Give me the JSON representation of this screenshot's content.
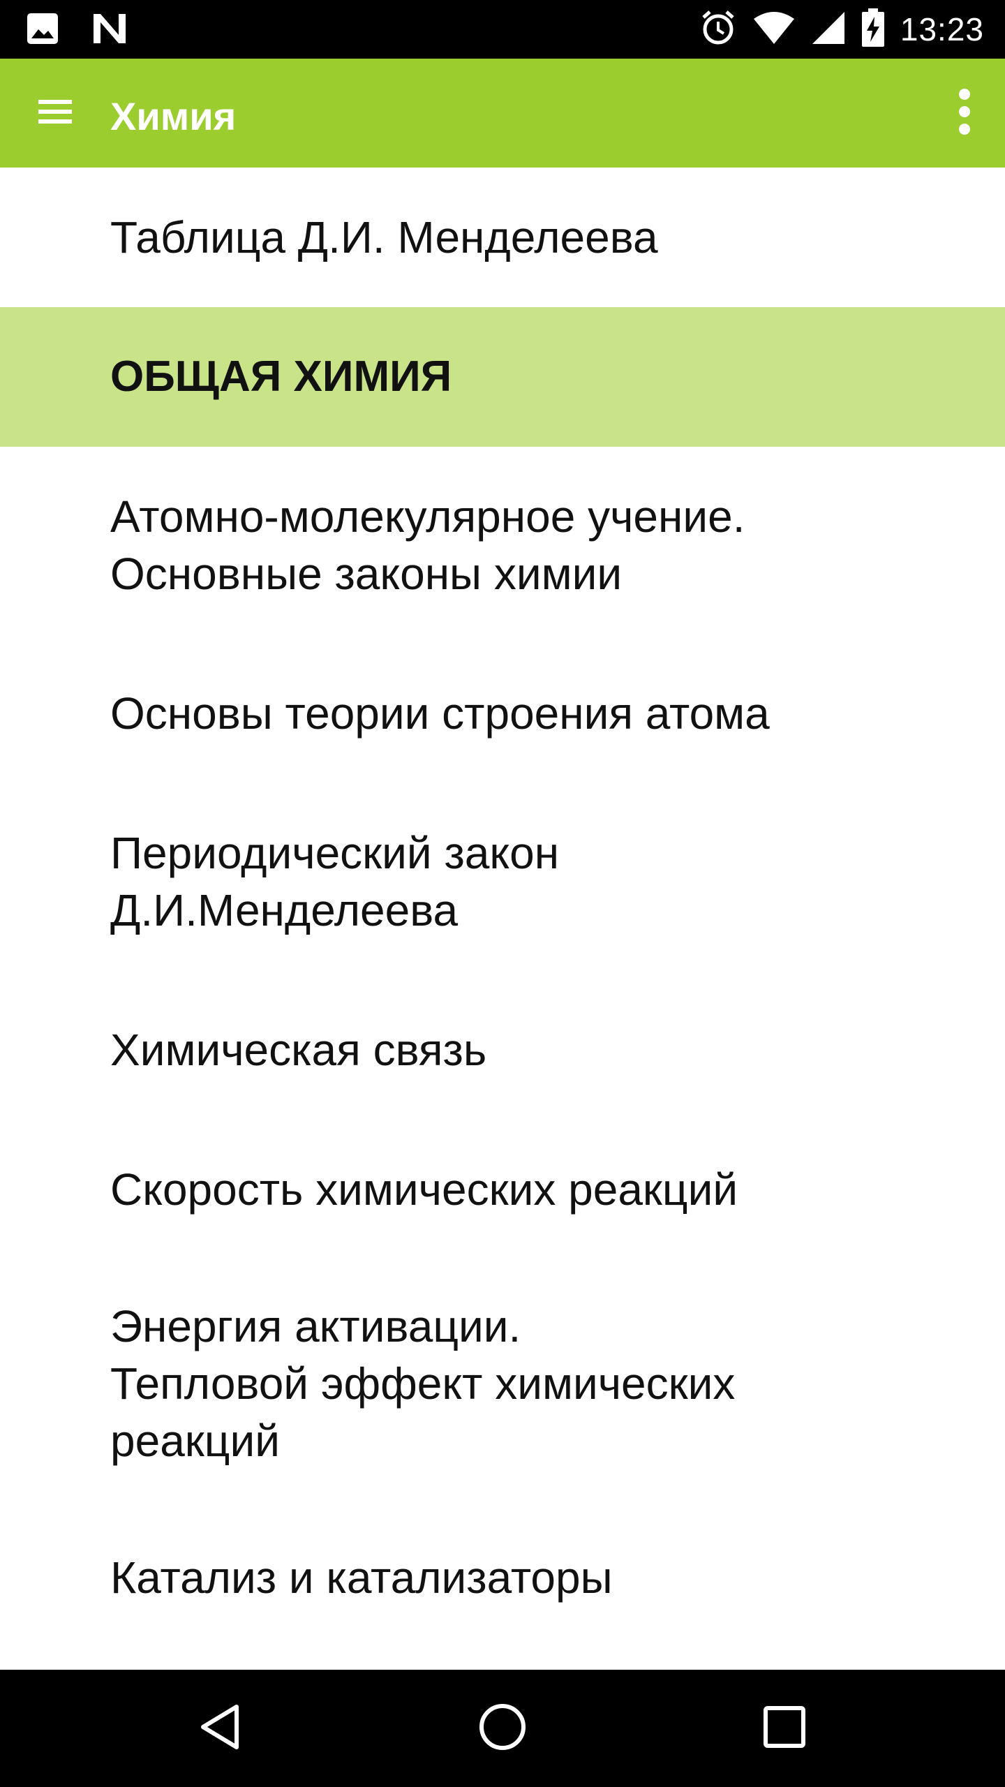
{
  "status_bar": {
    "time": "13:23",
    "left_icons": [
      "image-icon",
      "n-logo-icon"
    ],
    "right_icons": [
      "alarm-icon",
      "wifi-icon",
      "signal-icon",
      "battery-charging-icon"
    ]
  },
  "app_bar": {
    "title": "Химия",
    "menu_icon": "hamburger-menu-icon",
    "overflow_icon": "overflow-menu-icon",
    "color": "#9ccd2e"
  },
  "list": {
    "items": [
      {
        "label": "Таблица Д.И. Менделеева",
        "type": "item"
      },
      {
        "label": "ОБЩАЯ ХИМИЯ",
        "type": "section-header"
      },
      {
        "label": "Атомно-молекулярное учение.\nОсновные законы химии",
        "type": "item"
      },
      {
        "label": "Основы теории строения атома",
        "type": "item"
      },
      {
        "label": "Периодический закон\nД.И.Менделеева",
        "type": "item"
      },
      {
        "label": "Химическая связь",
        "type": "item"
      },
      {
        "label": "Скорость химических реакций",
        "type": "item"
      },
      {
        "label": "Энергия активации.\nТепловой эффект химических\nреакций",
        "type": "item"
      },
      {
        "label": "Катализ и катализаторы",
        "type": "item"
      }
    ],
    "header_color": "#c9e388"
  },
  "nav_bar": {
    "icons": [
      "back-icon",
      "home-icon",
      "recents-icon"
    ]
  }
}
